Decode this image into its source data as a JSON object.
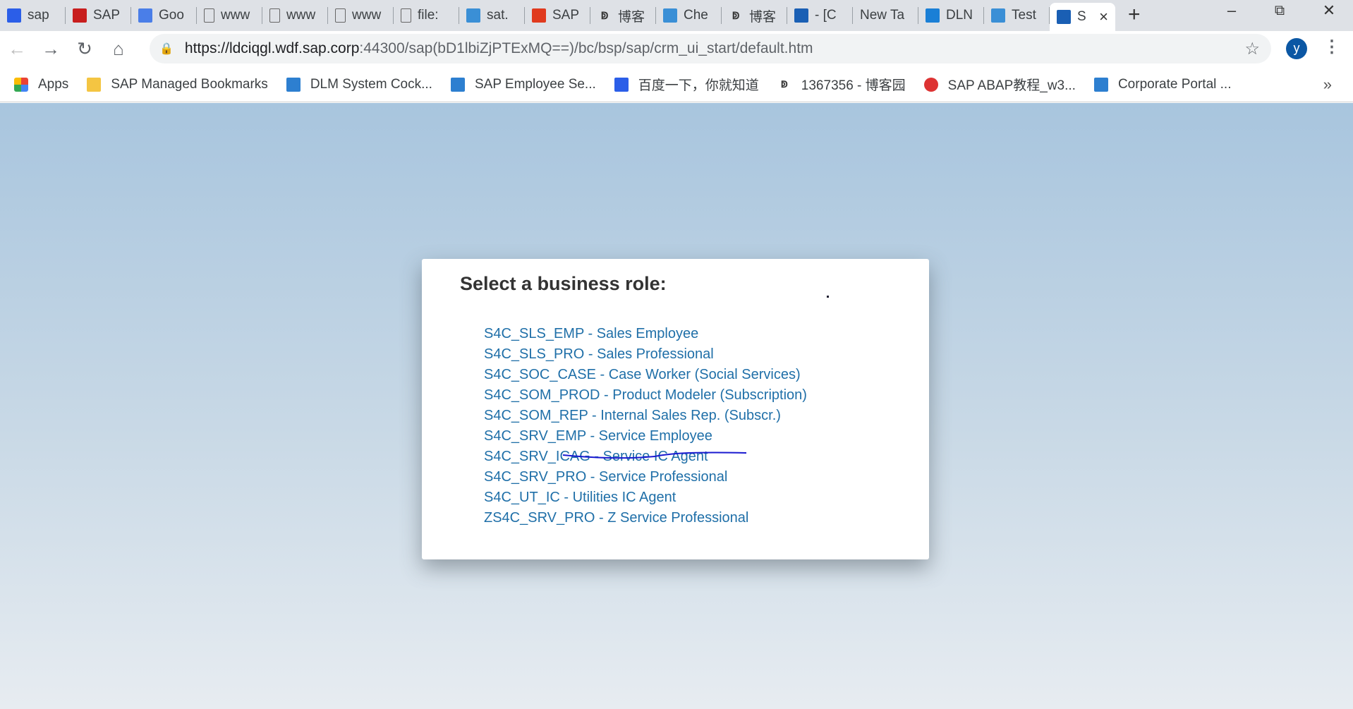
{
  "browser": {
    "tabs": [
      {
        "label": "sap",
        "icon": "baidu-paw-icon",
        "color": "#2b5ee8"
      },
      {
        "label": "SAP",
        "icon": "csdn-c-icon",
        "color": "#c81e1e"
      },
      {
        "label": "Goo",
        "icon": "google-translate-icon",
        "color": "#4a7ee8"
      },
      {
        "label": "www",
        "icon": "page-icon",
        "color": ""
      },
      {
        "label": "www",
        "icon": "page-icon",
        "color": ""
      },
      {
        "label": "www",
        "icon": "page-icon",
        "color": ""
      },
      {
        "label": "file:",
        "icon": "page-icon",
        "color": ""
      },
      {
        "label": "sat.",
        "icon": "sap-icon",
        "color": "#3a8fd6"
      },
      {
        "label": "SAP",
        "icon": "zhao-icon",
        "color": "#e03a1e"
      },
      {
        "label": "博客",
        "icon": "cnblogs-icon",
        "color": ""
      },
      {
        "label": "Che",
        "icon": "sap-icon",
        "color": "#3a8fd6"
      },
      {
        "label": "博客",
        "icon": "cnblogs-icon",
        "color": ""
      },
      {
        "label": "- [C",
        "icon": "sap-icon",
        "color": "#1a5fb4"
      },
      {
        "label": "New Ta",
        "icon": "",
        "color": ""
      },
      {
        "label": "DLN",
        "icon": "sap-icon",
        "color": "#1a7fd6"
      },
      {
        "label": "Test",
        "icon": "sap-icon",
        "color": "#3a8fd6"
      },
      {
        "label": "S",
        "icon": "sap-icon",
        "color": "#1a5fb4",
        "active": true
      }
    ],
    "url_host": "https://ldciqgl.wdf.sap.corp",
    "url_rest": ":44300/sap(bD1lbiZjPTExMQ==)/bc/bsp/sap/crm_ui_start/default.htm",
    "avatar_letter": "y",
    "bookmarks": [
      {
        "label": "Apps",
        "icon": "apps-grid-icon"
      },
      {
        "label": "SAP Managed Bookmarks",
        "icon": "folder-icon"
      },
      {
        "label": "DLM System Cock...",
        "icon": "sap-icon"
      },
      {
        "label": "SAP Employee Se...",
        "icon": "sap-icon"
      },
      {
        "label": "百度一下，你就知道",
        "icon": "baidu-paw-icon"
      },
      {
        "label": "1367356 - 博客园",
        "icon": "cnblogs-icon"
      },
      {
        "label": "SAP ABAP教程_w3...",
        "icon": "owl-icon"
      },
      {
        "label": "Corporate Portal ...",
        "icon": "sap-icon"
      }
    ]
  },
  "dialog": {
    "title": "Select a business role:",
    "roles": [
      "S4C_SLS_EMP - Sales Employee",
      "S4C_SLS_PRO - Sales Professional",
      "S4C_SOC_CASE - Case Worker (Social Services)",
      "S4C_SOM_PROD - Product Modeler (Subscription)",
      "S4C_SOM_REP - Internal Sales Rep. (Subscr.)",
      "S4C_SRV_EMP - Service Employee",
      "S4C_SRV_ICAG - Service IC Agent",
      "S4C_SRV_PRO - Service Professional",
      "S4C_UT_IC - Utilities IC Agent",
      "ZS4C_SRV_PRO - Z Service Professional"
    ],
    "link_color": "#1f6fa8",
    "annotation_color": "#1a1ad0"
  }
}
